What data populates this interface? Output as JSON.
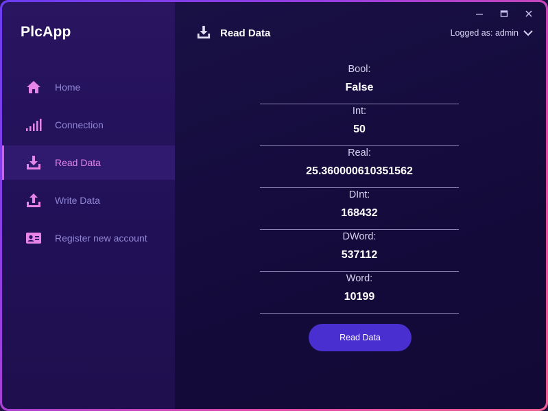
{
  "app": {
    "title": "PlcApp"
  },
  "window_controls": {
    "minimize": "—",
    "maximize": "▭",
    "close": "✕"
  },
  "sidebar": {
    "items": [
      {
        "label": "Home",
        "icon": "home-icon",
        "active": false
      },
      {
        "label": "Connection",
        "icon": "signal-icon",
        "active": false
      },
      {
        "label": "Read Data",
        "icon": "download-icon",
        "active": true
      },
      {
        "label": "Write Data",
        "icon": "upload-icon",
        "active": false
      },
      {
        "label": "Register new account",
        "icon": "id-card-icon",
        "active": false
      }
    ]
  },
  "header": {
    "title": "Read Data",
    "icon": "download-icon",
    "user_label": "Logged as: admin"
  },
  "fields": [
    {
      "label": "Bool:",
      "value": "False"
    },
    {
      "label": "Int:",
      "value": "50"
    },
    {
      "label": "Real:",
      "value": "25.360000610351562"
    },
    {
      "label": "DInt:",
      "value": "168432"
    },
    {
      "label": "DWord:",
      "value": "537112"
    },
    {
      "label": "Word:",
      "value": "10199"
    }
  ],
  "actions": {
    "read_button": "Read Data"
  },
  "colors": {
    "accent": "#e784e8",
    "button": "#4a2fd0",
    "nav_text": "#8f87d6"
  }
}
